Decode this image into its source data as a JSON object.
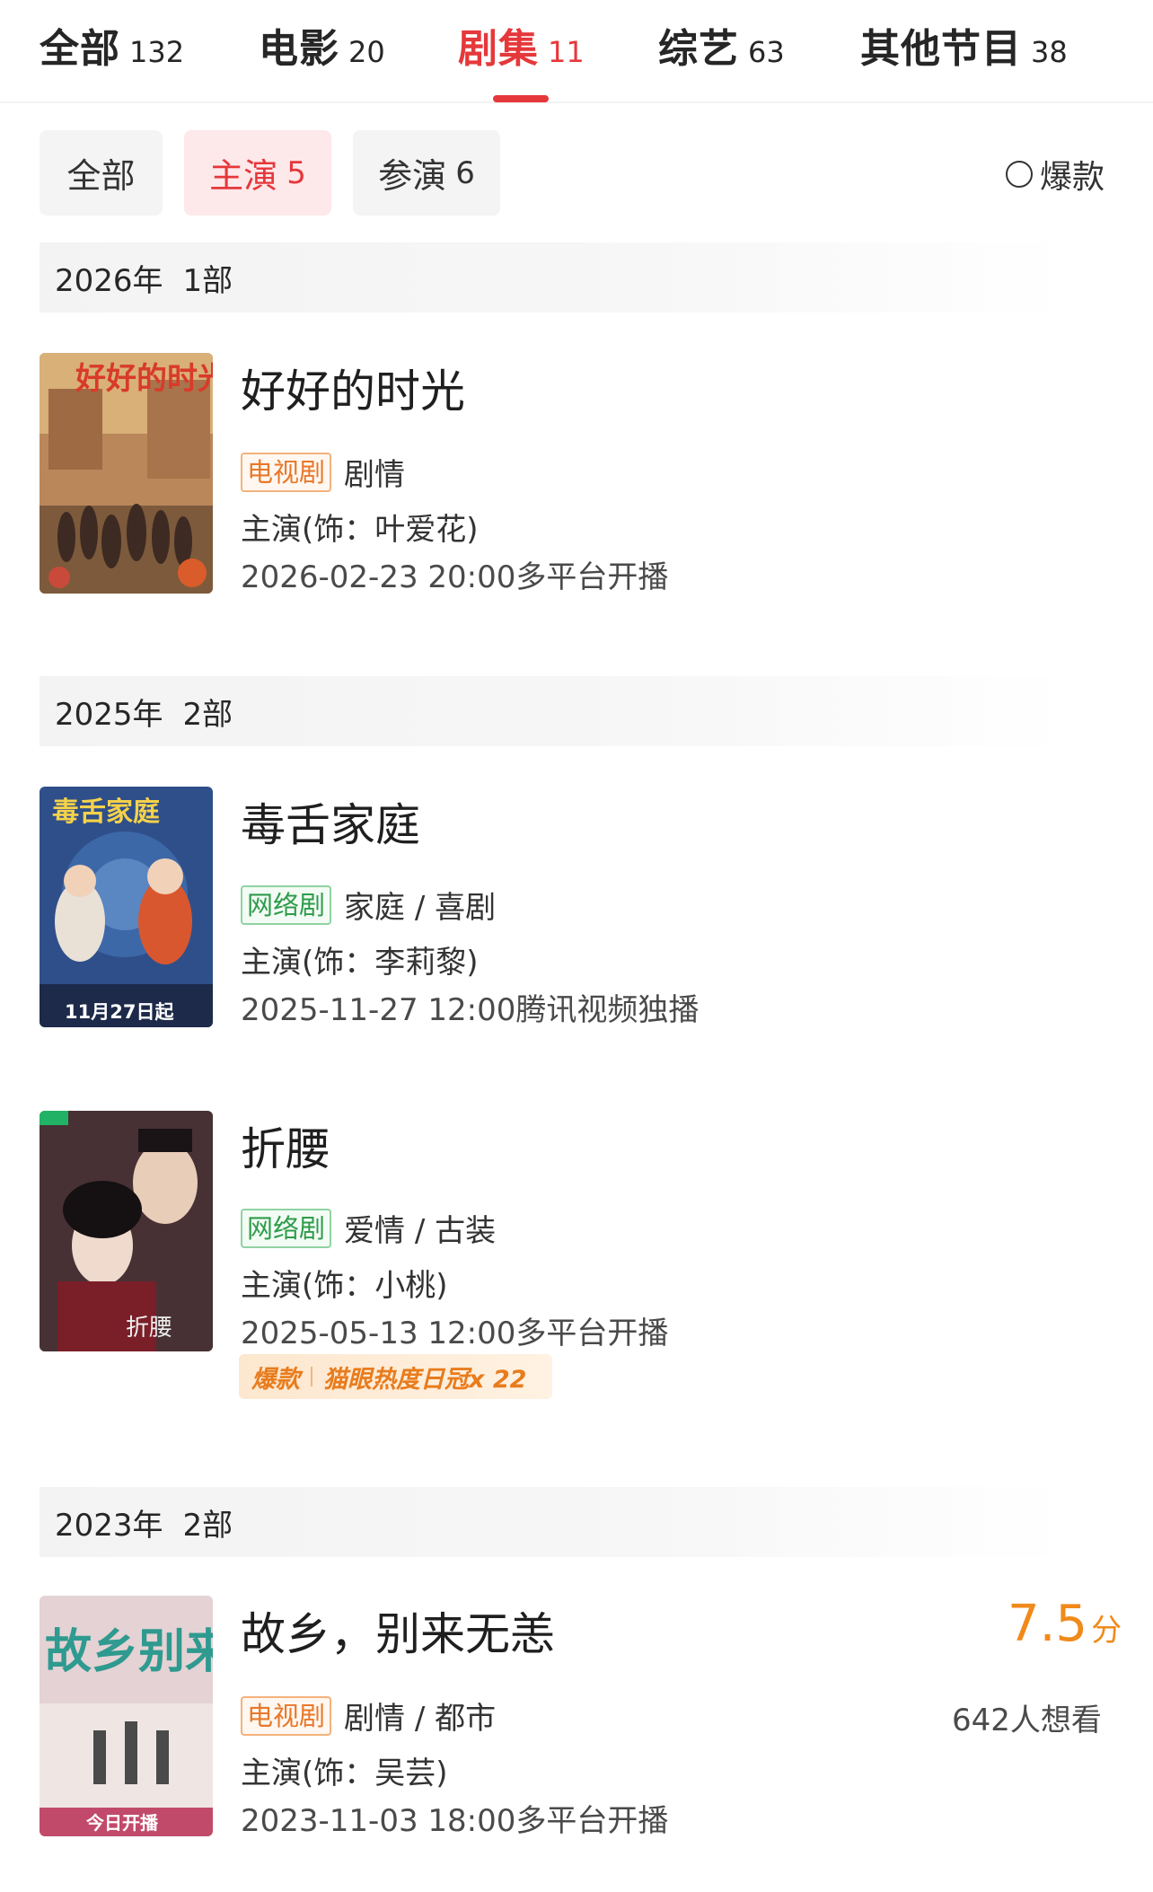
{
  "tabs": [
    {
      "label": "全部",
      "count": "132"
    },
    {
      "label": "电影",
      "count": "20"
    },
    {
      "label": "剧集",
      "count": "11"
    },
    {
      "label": "综艺",
      "count": "63"
    },
    {
      "label": "其他节目",
      "count": "38"
    }
  ],
  "active_tab": "剧集",
  "filters": [
    {
      "label": "全部",
      "count": ""
    },
    {
      "label": "主演",
      "count": "5"
    },
    {
      "label": "参演",
      "count": "6"
    }
  ],
  "active_filter": "主演",
  "toggle_label": "爆款",
  "groups": [
    {
      "year": "2026年",
      "count": "1部"
    },
    {
      "year": "2025年",
      "count": "2部"
    },
    {
      "year": "2023年",
      "count": "2部"
    }
  ],
  "shows": [
    {
      "title": "好好的时光",
      "badge": "电视剧",
      "genre": "剧情",
      "role": "主演(饰：叶爱花)",
      "date": "2026-02-23 20:00多平台开播",
      "poster_text": "好好的时光"
    },
    {
      "title": "毒舌家庭",
      "badge": "网络剧",
      "genre": "家庭 / 喜剧",
      "role": "主演(饰：李莉黎)",
      "date": "2025-11-27 12:00腾讯视频独播",
      "poster_text": "毒舌家庭",
      "poster_caption": "11月27日起"
    },
    {
      "title": "折腰",
      "badge": "网络剧",
      "genre": "爱情 / 古装",
      "role": "主演(饰：小桃)",
      "date": "2025-05-13 12:00多平台开播",
      "poster_text": "折腰",
      "hot_label": "爆款",
      "hot_text": "猫眼热度日冠x 22"
    },
    {
      "title": "故乡，别来无恙",
      "badge": "电视剧",
      "genre": "剧情 / 都市",
      "role": "主演(饰：吴芸)",
      "date": "2023-11-03 18:00多平台开播",
      "poster_text": "故乡别来无恙",
      "poster_caption": "今日开播",
      "score": "7.5",
      "score_unit": "分",
      "want": "642人想看"
    }
  ],
  "colors": {
    "accent": "#e5383b",
    "tv_badge": "#e8782a",
    "web_badge": "#2e9c4a",
    "score": "#f08a1a"
  }
}
